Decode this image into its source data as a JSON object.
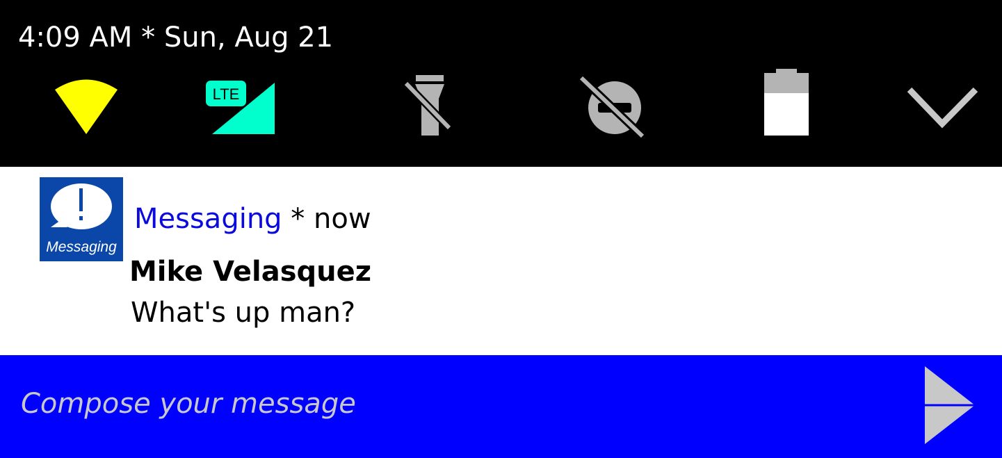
{
  "status_bar": {
    "datetime": "4:09 AM * Sun, Aug 21",
    "icons": [
      "wifi-icon",
      "cellular-lte-icon",
      "flashlight-off-icon",
      "data-saver-off-icon",
      "battery-icon",
      "expand-chevron-icon"
    ],
    "lte_label": "LTE",
    "colors": {
      "wifi": "#ffff00",
      "cellular": "#00ffcc",
      "inactive": "#b4b4b4",
      "background": "#000000"
    }
  },
  "notification": {
    "app_icon_label": "Messaging",
    "app_name": "Messaging",
    "separator": " * ",
    "time": "now",
    "sender": "Mike Velasquez",
    "message": "What's up man?",
    "colors": {
      "app_name": "#0a0adf",
      "app_icon_bg": "#0a47a8"
    }
  },
  "reply": {
    "placeholder": "Compose your message",
    "send_icon": "send-icon",
    "colors": {
      "background": "#0000ff"
    }
  }
}
